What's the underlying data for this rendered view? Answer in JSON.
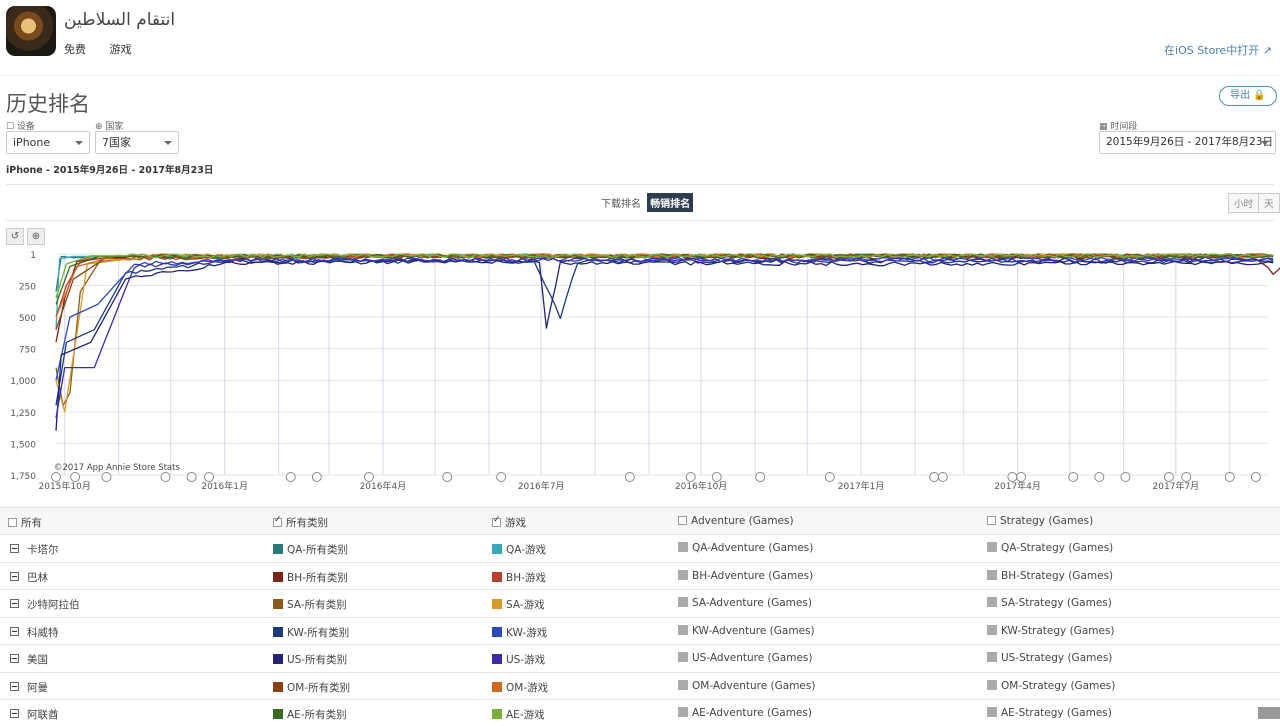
{
  "app": {
    "title": "انتقام السلاطين",
    "price": "免费",
    "category": "游戏",
    "ios_link": "在iOS Store中打开 ↗"
  },
  "page": {
    "title": "历史排名",
    "export_label": "导出 🔒",
    "subtitle": "iPhone - 2015年9月26日 - 2017年8月23日"
  },
  "filters": {
    "device_label": "☐ 设备",
    "device_value": "iPhone",
    "country_label": "⊕ 国家",
    "country_value": "7国家",
    "period_label": "▦ 时间段",
    "period_value": "2015年9月26日 - 2017年8月23日"
  },
  "chart_toggle": {
    "downloads": "下载排名",
    "grossing": "畅销排名"
  },
  "granularity": {
    "hour": "小时",
    "day": "天"
  },
  "chart_toolbar": {
    "reset": "↺",
    "zoom": "⊕"
  },
  "chart_data": {
    "type": "line",
    "title": "",
    "watermark": "©2017 App Annie Store Stats",
    "y_ticks": [
      "1",
      "250",
      "500",
      "750",
      "1,000",
      "1,250",
      "1,500",
      "1,750"
    ],
    "y_reversed": true,
    "ylim": [
      1,
      1750
    ],
    "x_ticks": [
      "2015年10月",
      "2016年1月",
      "2016年4月",
      "2016年7月",
      "2016年10月",
      "2017年1月",
      "2017年4月",
      "2017年7月"
    ],
    "xlim": [
      "2015-09-26",
      "2017-08-23"
    ],
    "grid": true,
    "series": [
      {
        "name": "QA-所有类别",
        "color": "#2a7a7a",
        "values": [
          [
            0,
            300
          ],
          [
            3,
            20
          ],
          [
            10,
            30
          ],
          [
            30,
            20
          ],
          [
            100,
            25
          ],
          [
            300,
            20
          ],
          [
            500,
            22
          ],
          [
            700,
            25
          ]
        ]
      },
      {
        "name": "QA-游戏",
        "color": "#3aa8b8",
        "values": [
          [
            0,
            600
          ],
          [
            2,
            40
          ],
          [
            10,
            20
          ],
          [
            100,
            15
          ],
          [
            400,
            15
          ],
          [
            700,
            18
          ]
        ]
      },
      {
        "name": "BH-所有类别",
        "color": "#7a2418",
        "values": [
          [
            0,
            700
          ],
          [
            5,
            350
          ],
          [
            12,
            60
          ],
          [
            30,
            30
          ],
          [
            200,
            20
          ],
          [
            690,
            30
          ],
          [
            700,
            150
          ],
          [
            710,
            20
          ]
        ]
      },
      {
        "name": "BH-游戏",
        "color": "#b8402a",
        "values": [
          [
            0,
            500
          ],
          [
            6,
            250
          ],
          [
            15,
            40
          ],
          [
            200,
            15
          ],
          [
            700,
            20
          ]
        ]
      },
      {
        "name": "SA-所有类别",
        "color": "#8a5a1a",
        "values": [
          [
            0,
            900
          ],
          [
            4,
            1200
          ],
          [
            8,
            1100
          ],
          [
            14,
            300
          ],
          [
            25,
            60
          ],
          [
            60,
            25
          ],
          [
            700,
            15
          ]
        ]
      },
      {
        "name": "SA-游戏",
        "color": "#d89a28",
        "values": [
          [
            0,
            1000
          ],
          [
            5,
            1250
          ],
          [
            9,
            900
          ],
          [
            18,
            80
          ],
          [
            60,
            10
          ],
          [
            700,
            10
          ]
        ]
      },
      {
        "name": "KW-所有类别",
        "color": "#1a3a7a",
        "values": [
          [
            0,
            1200
          ],
          [
            6,
            700
          ],
          [
            22,
            600
          ],
          [
            40,
            150
          ],
          [
            100,
            60
          ],
          [
            275,
            60
          ],
          [
            290,
            500
          ],
          [
            300,
            60
          ],
          [
            700,
            60
          ]
        ]
      },
      {
        "name": "KW-游戏",
        "color": "#2a4ab8",
        "values": [
          [
            0,
            1000
          ],
          [
            8,
            500
          ],
          [
            24,
            400
          ],
          [
            45,
            80
          ],
          [
            100,
            50
          ],
          [
            700,
            40
          ]
        ]
      },
      {
        "name": "US-所有类别",
        "color": "#22227a",
        "values": [
          [
            0,
            1400
          ],
          [
            3,
            800
          ],
          [
            20,
            700
          ],
          [
            40,
            200
          ],
          [
            100,
            70
          ],
          [
            278,
            60
          ],
          [
            282,
            600
          ],
          [
            290,
            70
          ],
          [
            500,
            80
          ],
          [
            700,
            70
          ]
        ]
      },
      {
        "name": "US-游戏",
        "color": "#3a2ab0",
        "values": [
          [
            0,
            1300
          ],
          [
            5,
            900
          ],
          [
            22,
            900
          ],
          [
            45,
            100
          ],
          [
            100,
            50
          ],
          [
            700,
            50
          ]
        ]
      },
      {
        "name": "OM-所有类别",
        "color": "#8a4010",
        "values": [
          [
            0,
            600
          ],
          [
            10,
            200
          ],
          [
            30,
            20
          ],
          [
            700,
            10
          ]
        ]
      },
      {
        "name": "OM-游戏",
        "color": "#d06a20",
        "values": [
          [
            0,
            500
          ],
          [
            12,
            100
          ],
          [
            35,
            15
          ],
          [
            700,
            10
          ]
        ]
      },
      {
        "name": "AE-所有类别",
        "color": "#3a6a20",
        "values": [
          [
            0,
            400
          ],
          [
            8,
            100
          ],
          [
            25,
            20
          ],
          [
            700,
            15
          ]
        ]
      },
      {
        "name": "AE-游戏",
        "color": "#7ab03a",
        "values": [
          [
            0,
            350
          ],
          [
            6,
            80
          ],
          [
            20,
            15
          ],
          [
            700,
            12
          ]
        ]
      }
    ]
  },
  "legend": {
    "headers": [
      "所有",
      "所有类别",
      "游戏",
      "Adventure (Games)",
      "Strategy (Games)"
    ],
    "header_checked": [
      false,
      true,
      true,
      false,
      false
    ],
    "rows": [
      {
        "country": "卡塔尔",
        "all": "QA-所有类别",
        "games": "QA-游戏",
        "adventure": "QA-Adventure (Games)",
        "strategy": "QA-Strategy (Games)",
        "c1": "#2a7a7a",
        "c2": "#3aa8b8"
      },
      {
        "country": "巴林",
        "all": "BH-所有类别",
        "games": "BH-游戏",
        "adventure": "BH-Adventure (Games)",
        "strategy": "BH-Strategy (Games)",
        "c1": "#7a2418",
        "c2": "#b8402a"
      },
      {
        "country": "沙特阿拉伯",
        "all": "SA-所有类别",
        "games": "SA-游戏",
        "adventure": "SA-Adventure (Games)",
        "strategy": "SA-Strategy (Games)",
        "c1": "#8a5a1a",
        "c2": "#d89a28"
      },
      {
        "country": "科威特",
        "all": "KW-所有类别",
        "games": "KW-游戏",
        "adventure": "KW-Adventure (Games)",
        "strategy": "KW-Strategy (Games)",
        "c1": "#1a3a7a",
        "c2": "#2a4ab8"
      },
      {
        "country": "美国",
        "all": "US-所有类别",
        "games": "US-游戏",
        "adventure": "US-Adventure (Games)",
        "strategy": "US-Strategy (Games)",
        "c1": "#22227a",
        "c2": "#3a2ab0"
      },
      {
        "country": "阿曼",
        "all": "OM-所有类别",
        "games": "OM-游戏",
        "adventure": "OM-Adventure (Games)",
        "strategy": "OM-Strategy (Games)",
        "c1": "#8a4010",
        "c2": "#d06a20"
      },
      {
        "country": "阿联酋",
        "all": "AE-所有类别",
        "games": "AE-游戏",
        "adventure": "AE-Adventure (Games)",
        "strategy": "AE-Strategy (Games)",
        "c1": "#3a6a20",
        "c2": "#7ab03a"
      }
    ]
  }
}
